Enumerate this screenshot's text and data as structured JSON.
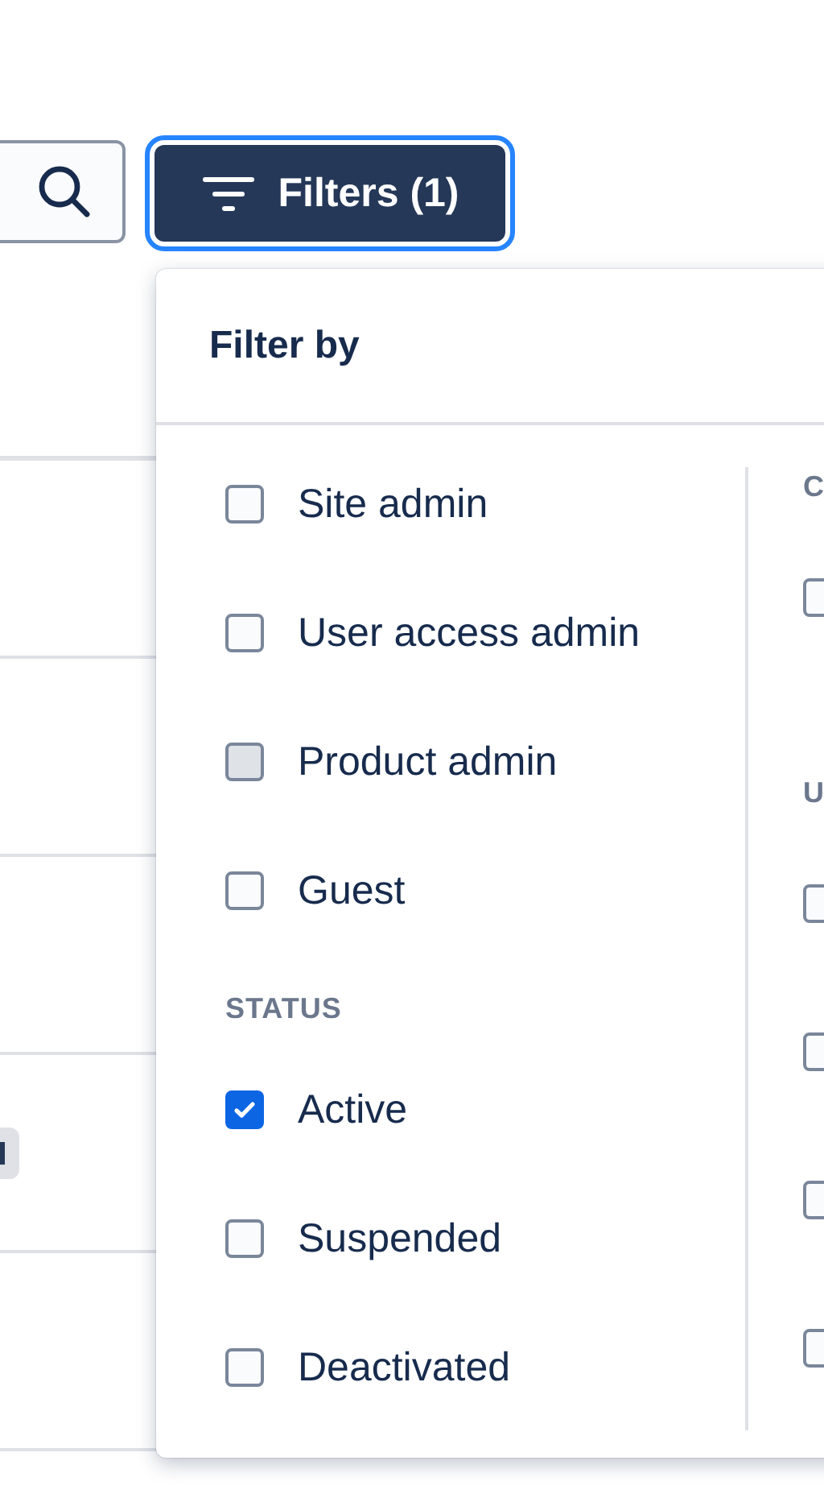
{
  "filter_button": {
    "label": "Filters (1)",
    "focused": true
  },
  "table": {
    "rows": [
      {
        "tag": false
      },
      {
        "tag": false
      },
      {
        "tag": false
      },
      {
        "tag": true
      },
      {
        "tag": false
      }
    ]
  },
  "filter_panel": {
    "title": "Filter by",
    "columns": [
      {
        "sections": [
          {
            "items": [
              {
                "label": "Site admin",
                "checked": false,
                "hovered": false
              },
              {
                "label": "User access admin",
                "checked": false,
                "hovered": false
              },
              {
                "label": "Product admin",
                "checked": false,
                "hovered": true
              },
              {
                "label": "Guest",
                "checked": false,
                "hovered": false
              }
            ]
          },
          {
            "heading": "STATUS",
            "items": [
              {
                "label": "Active",
                "checked": true,
                "hovered": false
              },
              {
                "label": "Suspended",
                "checked": false,
                "hovered": false
              },
              {
                "label": "Deactivated",
                "checked": false,
                "hovered": false
              }
            ]
          }
        ]
      },
      {
        "sections": [
          {
            "heading": "C",
            "items": [
              {
                "checked": false,
                "hovered": false
              }
            ]
          },
          {
            "heading": "U",
            "items": [
              {
                "checked": false,
                "hovered": false
              },
              {
                "checked": false,
                "hovered": false
              },
              {
                "checked": false,
                "hovered": false
              },
              {
                "checked": false,
                "hovered": false
              }
            ]
          }
        ]
      }
    ]
  }
}
